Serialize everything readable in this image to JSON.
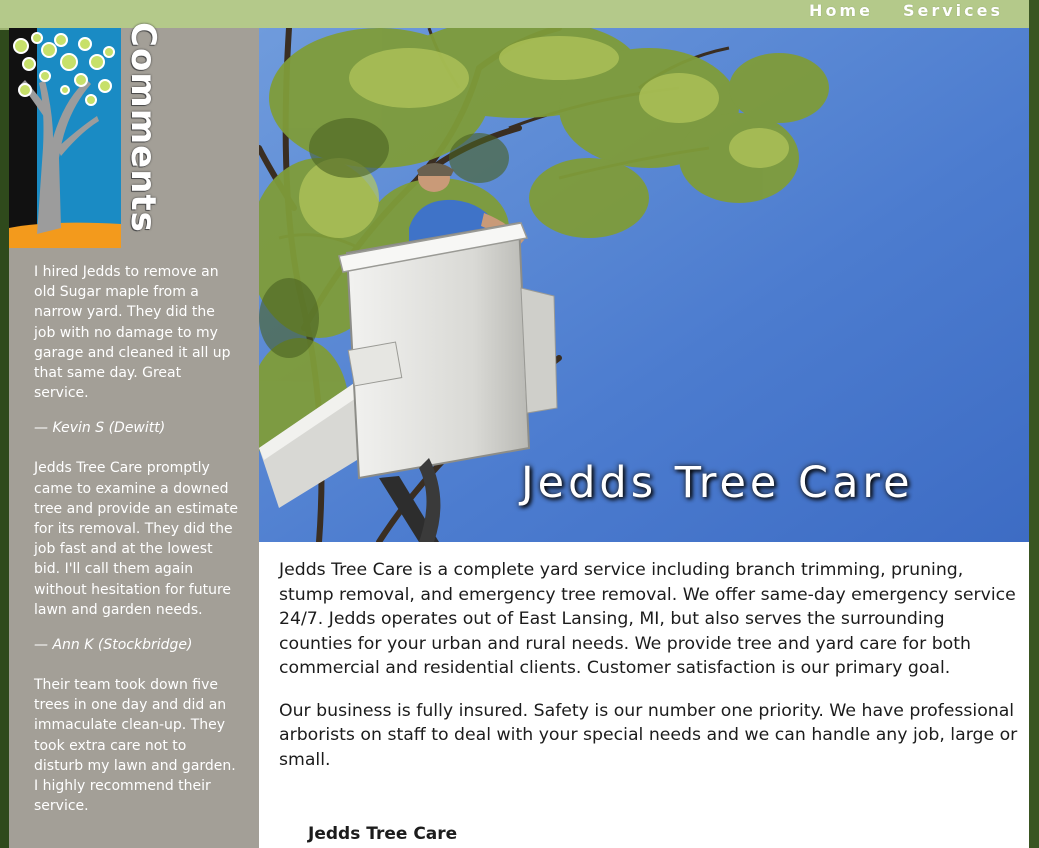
{
  "nav": {
    "home": "Home",
    "services": "Services"
  },
  "sidebar": {
    "title": "Comments",
    "testimonials": [
      {
        "text": "I hired Jedds to remove an old Sugar maple from a narrow yard. They did the job with no damage to my garage and cleaned it all up that same day. Great service.",
        "author": "— Kevin S (Dewitt)"
      },
      {
        "text": "Jedds Tree Care promptly came to examine a downed tree and provide an estimate for its removal. They did the job fast and at the lowest bid. I'll call them again without hesitation for future lawn and garden needs.",
        "author": "— Ann K (Stockbridge)"
      },
      {
        "text": "Their team took down five trees in one day and did an immaculate clean-up. They took extra care not to disturb my lawn and garden. I highly recommend their service."
      }
    ]
  },
  "hero": {
    "title": "Jedds Tree Care"
  },
  "content": {
    "paragraph1": "Jedds Tree Care is a complete yard service including branch trimming, pruning, stump removal, and emergency tree removal. We offer same-day emergency service 24/7. Jedds operates out of East Lansing, MI, but also serves the surrounding counties for your urban and rural needs. We provide tree and yard care for both commercial and residential clients. Customer satisfaction is our primary goal.",
    "paragraph2": "Our business is fully insured. Safety is our number one priority. We have professional arborists on staff to deal with your special needs and we can handle any job, large or small.",
    "footer_name": "Jedds Tree Care"
  },
  "colors": {
    "topbar": "#b4c98a",
    "sidebar": "#a39f97",
    "page_bg": "#3f5a26",
    "sky": "#4f7fd0"
  }
}
